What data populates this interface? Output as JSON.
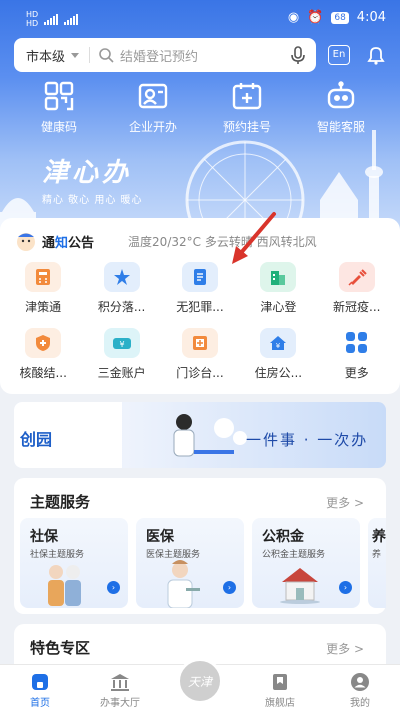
{
  "status_bar": {
    "time": "4:04",
    "battery": "68",
    "left_tags": [
      "HD",
      "HD"
    ]
  },
  "search": {
    "city": "市本级",
    "placeholder": "结婚登记预约",
    "en_label": "En"
  },
  "quick_actions": [
    {
      "label": "健康码",
      "icon": "qrcode-icon"
    },
    {
      "label": "企业开办",
      "icon": "id-card-icon"
    },
    {
      "label": "预约挂号",
      "icon": "medical-calendar-icon"
    },
    {
      "label": "智能客服",
      "icon": "robot-icon"
    }
  ],
  "brand": {
    "title": "津心办",
    "slogan": "精心 敬心 用心 暖心"
  },
  "notice": {
    "title_a": "通",
    "title_b": "知",
    "title_c": "公告",
    "weather": "温度20/32°C 多云转晴 西风转北风"
  },
  "services": [
    [
      {
        "label": "津策通",
        "icon": "calculator-icon",
        "color": "#f28a3c",
        "bg": "#fdeee2"
      },
      {
        "label": "积分落...",
        "icon": "star-badge-icon",
        "color": "#2f7ee8",
        "bg": "#e3eefc"
      },
      {
        "label": "无犯罪...",
        "icon": "document-icon",
        "color": "#2f7ee8",
        "bg": "#e3eefc"
      },
      {
        "label": "津心登",
        "icon": "building-icon",
        "color": "#20b07a",
        "bg": "#def5eb"
      },
      {
        "label": "新冠疫...",
        "icon": "syringe-icon",
        "color": "#e8503c",
        "bg": "#fde6e2"
      }
    ],
    [
      {
        "label": "核酸结...",
        "icon": "shield-plus-icon",
        "color": "#f28a3c",
        "bg": "#fdeee2"
      },
      {
        "label": "三金账户",
        "icon": "money-icon",
        "color": "#2bb0c8",
        "bg": "#ddf4f8"
      },
      {
        "label": "门诊台...",
        "icon": "clinic-icon",
        "color": "#f28a3c",
        "bg": "#fdeee2"
      },
      {
        "label": "住房公...",
        "icon": "house-yen-icon",
        "color": "#2f7ee8",
        "bg": "#e3eefc"
      },
      {
        "label": "更多",
        "icon": "grid-more-icon",
        "color": "#2f7ee8",
        "bg": "#ffffff"
      }
    ]
  ],
  "banner": {
    "left_text": "创园",
    "slogan": "一件事 · 一次办"
  },
  "theme": {
    "title": "主题服务",
    "more": "更多 >",
    "cards": [
      {
        "name": "社保",
        "desc": "社保主题服务"
      },
      {
        "name": "医保",
        "desc": "医保主题服务"
      },
      {
        "name": "公积金",
        "desc": "公积金主题服务"
      },
      {
        "name": "养",
        "desc": "养"
      }
    ]
  },
  "special": {
    "title": "特色专区",
    "more": "更多 >"
  },
  "tabbar": [
    {
      "label": "首页",
      "icon": "home-icon",
      "active": true
    },
    {
      "label": "办事大厅",
      "icon": "hall-icon",
      "active": false
    },
    {
      "label": "天津",
      "icon": "city-logo-icon",
      "active": false
    },
    {
      "label": "旗舰店",
      "icon": "flag-store-icon",
      "active": false
    },
    {
      "label": "我的",
      "icon": "user-icon",
      "active": false
    }
  ],
  "colors": {
    "primary": "#1e6fe6",
    "hero_top": "#3a75e6"
  }
}
